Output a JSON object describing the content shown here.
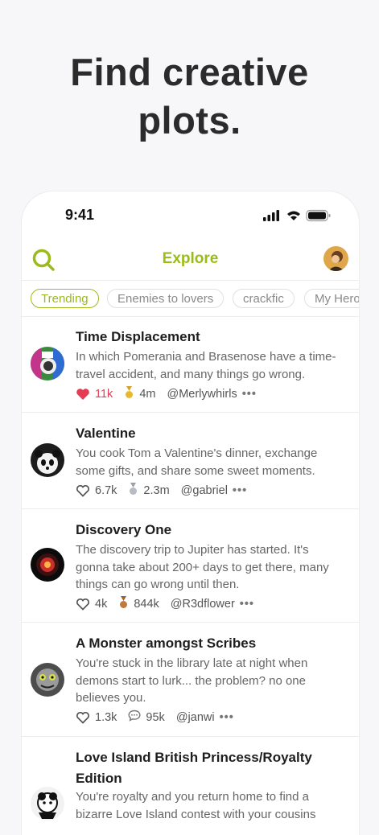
{
  "headline": {
    "line1": "Find creative",
    "line2": "plots."
  },
  "status_bar": {
    "time": "9:41"
  },
  "nav": {
    "title": "Explore"
  },
  "chips": [
    "Trending",
    "Enemies to lovers",
    "crackfic",
    "My Hero"
  ],
  "stories": [
    {
      "title": "Time Displacement",
      "desc": [
        "In which Pomerania and Brasenose have a time-",
        "travel accident, and many things go wrong."
      ],
      "likes": "11k",
      "stat": "4m",
      "author": "@Merlywhirls",
      "more": "•••"
    },
    {
      "title": "Valentine",
      "desc": [
        "You cook Tom a Valentine's dinner, exchange",
        "some gifts, and share some sweet moments."
      ],
      "likes": "6.7k",
      "stat": "2.3m",
      "author": "@gabriel",
      "more": "•••"
    },
    {
      "title": "Discovery One",
      "desc": [
        "The discovery trip to Jupiter has started. It's",
        "gonna take about 200+ days to get there, many",
        "things can go wrong until then."
      ],
      "likes": "4k",
      "stat": "844k",
      "author": "@R3dflower",
      "more": "•••"
    },
    {
      "title": "A Monster amongst Scribes",
      "desc": [
        "You're stuck in the library late at night when",
        "demons start to lurk... the problem? no one",
        "believes you."
      ],
      "likes": "1.3k",
      "stat": "95k",
      "author": "@janwi",
      "more": "•••"
    },
    {
      "title_lines": [
        "Love Island British Princess/Royalty",
        "Edition"
      ],
      "desc": [
        "You're royalty and you return home to find a",
        "bizarre Love Island contest with your cousins"
      ]
    }
  ],
  "colors": {
    "accent": "#9bbb1c",
    "like": "#e33d55"
  }
}
